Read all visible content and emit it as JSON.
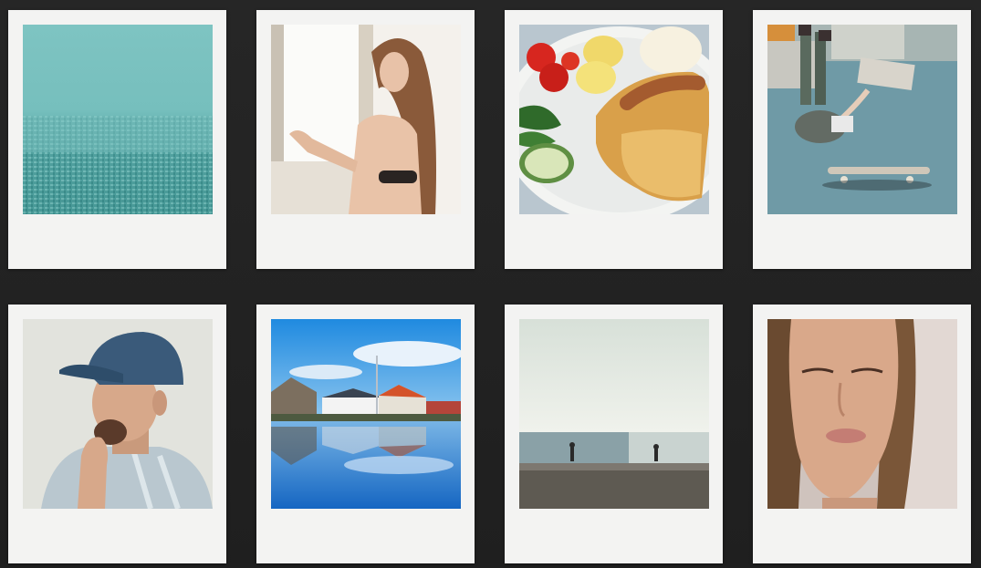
{
  "gallery": {
    "photos": [
      {
        "subject": "foggy-city-aerial",
        "caption": ""
      },
      {
        "subject": "woman-by-window",
        "caption": ""
      },
      {
        "subject": "hot-dog-plate",
        "caption": ""
      },
      {
        "subject": "skateboard-fall",
        "caption": ""
      },
      {
        "subject": "man-denim-cap",
        "caption": ""
      },
      {
        "subject": "harbor-reflection",
        "caption": ""
      },
      {
        "subject": "beach-silhouettes",
        "caption": ""
      },
      {
        "subject": "woman-portrait",
        "caption": ""
      }
    ]
  },
  "colors": {
    "background": "#222222",
    "frame": "#f3f3f2"
  }
}
